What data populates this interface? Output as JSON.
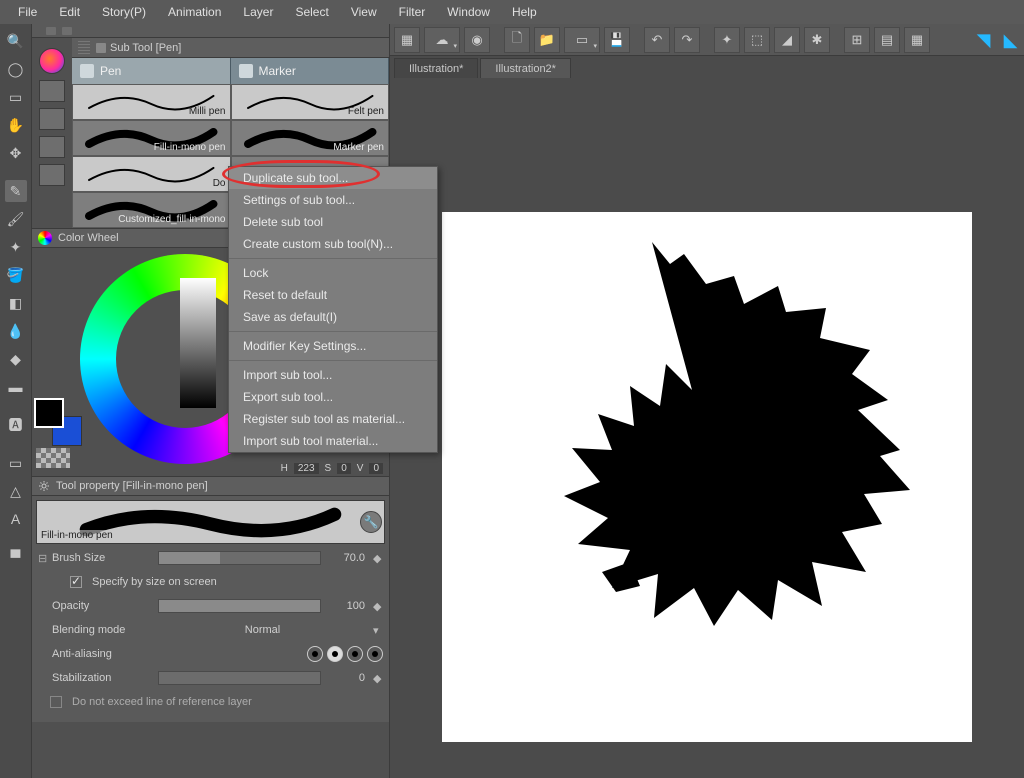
{
  "menus": [
    "File",
    "Edit",
    "Story(P)",
    "Animation",
    "Layer",
    "Select",
    "View",
    "Filter",
    "Window",
    "Help"
  ],
  "subtool_tab_title": "Sub Tool [Pen]",
  "subtool_groups": [
    {
      "label": "Pen"
    },
    {
      "label": "Marker"
    }
  ],
  "pens": [
    [
      {
        "label": "Milli pen",
        "light": true
      },
      {
        "label": "Felt pen",
        "light": true
      }
    ],
    [
      {
        "label": "Fill-in-mono pen",
        "light": false
      },
      {
        "label": "Marker pen",
        "light": false
      }
    ],
    [
      {
        "label": "Do",
        "light": true
      },
      {
        "label": "",
        "light": false,
        "blank": true
      }
    ],
    [
      {
        "label": "Customized_fill-in-mono",
        "light": false
      },
      {
        "label": "",
        "light": false,
        "blank": true
      }
    ]
  ],
  "color_wheel_title": "Color Wheel",
  "hsv": {
    "h_label": "H",
    "h": "223",
    "s_label": "S",
    "s": "0",
    "v_label": "V",
    "v": "0"
  },
  "tool_property_title": "Tool property [Fill-in-mono pen]",
  "preview_label": "Fill-in-mono pen",
  "brush_size_label": "Brush Size",
  "brush_size_value": "70.0",
  "specify_label": "Specify by size on screen",
  "opacity_label": "Opacity",
  "opacity_value": "100",
  "blend_label": "Blending mode",
  "blend_value": "Normal",
  "aa_label": "Anti-aliasing",
  "stab_label": "Stabilization",
  "stab_value": "0",
  "exceed_label": "Do not exceed line of reference layer",
  "context_menu": [
    {
      "label": "Duplicate sub tool...",
      "highlight": true
    },
    {
      "label": "Settings of sub tool..."
    },
    {
      "label": "Delete sub tool"
    },
    {
      "label": "Create custom sub tool(N)..."
    },
    {
      "sep": true
    },
    {
      "label": "Lock"
    },
    {
      "label": "Reset to default"
    },
    {
      "label": "Save as default(I)"
    },
    {
      "sep": true
    },
    {
      "label": "Modifier Key Settings..."
    },
    {
      "sep": true
    },
    {
      "label": "Import sub tool..."
    },
    {
      "label": "Export sub tool..."
    },
    {
      "label": "Register sub tool as material..."
    },
    {
      "label": "Import sub tool material..."
    }
  ],
  "file_tabs": [
    {
      "label": "Illustration*"
    },
    {
      "label": "Illustration2*",
      "active": true
    }
  ]
}
